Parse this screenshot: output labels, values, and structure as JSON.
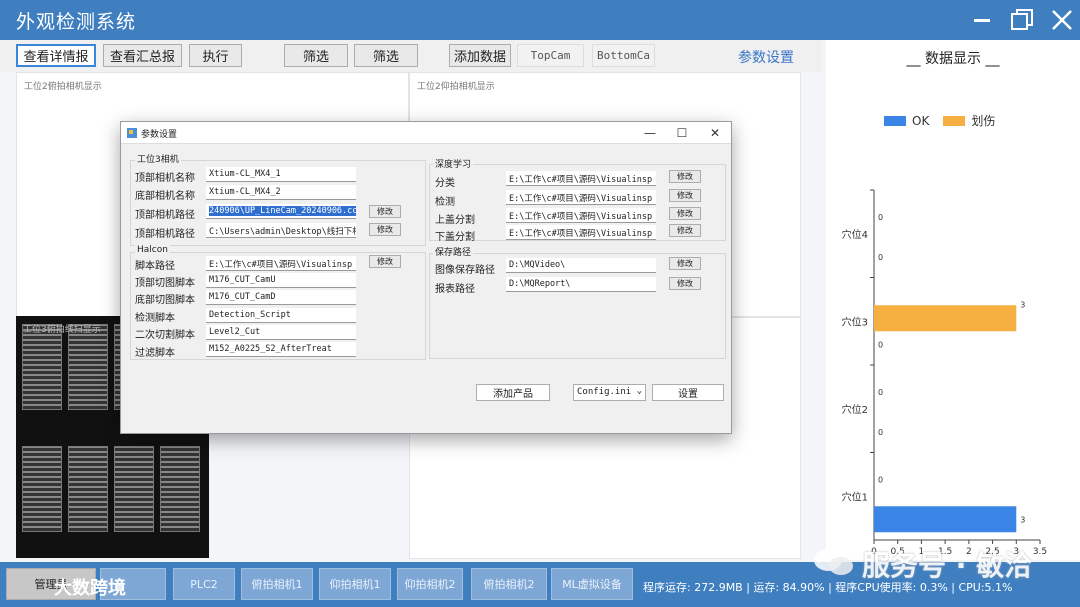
{
  "app": {
    "title": "外观检测系统"
  },
  "toolbar": {
    "view_detail": "查看详情报",
    "view_summary": "查看汇总报",
    "execute": "执行",
    "filter1": "筛选",
    "filter2": "筛选",
    "add_data": "添加数据",
    "top_cam": "TopCam",
    "bottom_cam": "BottomCa",
    "param_settings": "参数设置"
  },
  "panels": {
    "left_top": "工位2俯拍相机显示",
    "right_top": "工位2仰拍相机显示",
    "left_bottom": "工位3俯拍线扫显示"
  },
  "dialog": {
    "title": "参数设置",
    "group_cam": "工位3相机",
    "top_cam_name_label": "顶部相机名称",
    "top_cam_name": "Xtium-CL_MX4_1",
    "bottom_cam_name_label": "底部相机名称",
    "bottom_cam_name": "Xtium-CL_MX4_2",
    "top_cam_path_label": "顶部相机路径",
    "top_cam_path": "240906\\UP_LineCam_20240906.ccf",
    "bottom_cam_path_label": "顶部相机路径",
    "bottom_cam_path": "C:\\Users\\admin\\Desktop\\线扫下相",
    "modify": "修改",
    "group_halcon": "Halcon",
    "script_path_label": "脚本路径",
    "script_path": "E:\\工作\\c#项目\\源码\\Visualinsp",
    "top_cut_label": "顶部切图脚本",
    "top_cut": "M176_CUT_CamU",
    "bottom_cut_label": "底部切图脚本",
    "bottom_cut": "M176_CUT_CamD",
    "detect_label": "检测脚本",
    "detect": "Detection_Script",
    "second_cut_label": "二次切割脚本",
    "second_cut": "Level2_Cut",
    "filter_label": "过滤脚本",
    "filter": "M152_A0225_S2_AfterTreat",
    "group_dl": "深度学习",
    "classify_label": "分类",
    "classify": "E:\\工作\\c#项目\\源码\\Visualinsp",
    "detect_dl_label": "检测",
    "detect_dl": "E:\\工作\\c#项目\\源码\\Visualinsp",
    "upper_seg_label": "上盖分割",
    "upper_seg": "E:\\工作\\c#项目\\源码\\Visualinsp",
    "lower_seg_label": "下盖分割",
    "lower_seg": "E:\\工作\\c#项目\\源码\\Visualinsp",
    "group_save": "保存路径",
    "img_save_label": "图像保存路径",
    "img_save": "D:\\MQVideo\\",
    "report_label": "报表路径",
    "report": "D:\\MQReport\\",
    "add_product": "添加产品",
    "config": "Config.ini",
    "settings": "设置"
  },
  "right_panel": {
    "title": "__ 数据显示 __"
  },
  "chart_data": {
    "type": "bar",
    "orientation": "horizontal",
    "categories": [
      "穴位1",
      "穴位2",
      "穴位3",
      "穴位4"
    ],
    "series": [
      {
        "name": "OK",
        "values": [
          3,
          0,
          0,
          0
        ],
        "color": "#3a85e6"
      },
      {
        "name": "划伤",
        "values": [
          0,
          0,
          3,
          0
        ],
        "color": "#f5b041"
      }
    ],
    "xlim": [
      0,
      3.5
    ],
    "xticks": [
      "0",
      "0.5",
      "1",
      "1.5",
      "2",
      "2.5",
      "3",
      "3.5"
    ],
    "legend_position": "top"
  },
  "statusbar": {
    "user": "管理员",
    "plc": "PLC2",
    "cam1": "俯拍相机1",
    "cam2": "仰拍相机1",
    "cam3": "仰拍相机2",
    "cam4": "俯拍相机2",
    "ml": "ML虚拟设备",
    "sys_info": "程序运存: 272.9MB | 运存: 84.90% | 程序CPU使用率: 0.3% | CPU:5.1%",
    "overlay_text": "大数跨境"
  },
  "watermark": "服务号 · 敏洽"
}
